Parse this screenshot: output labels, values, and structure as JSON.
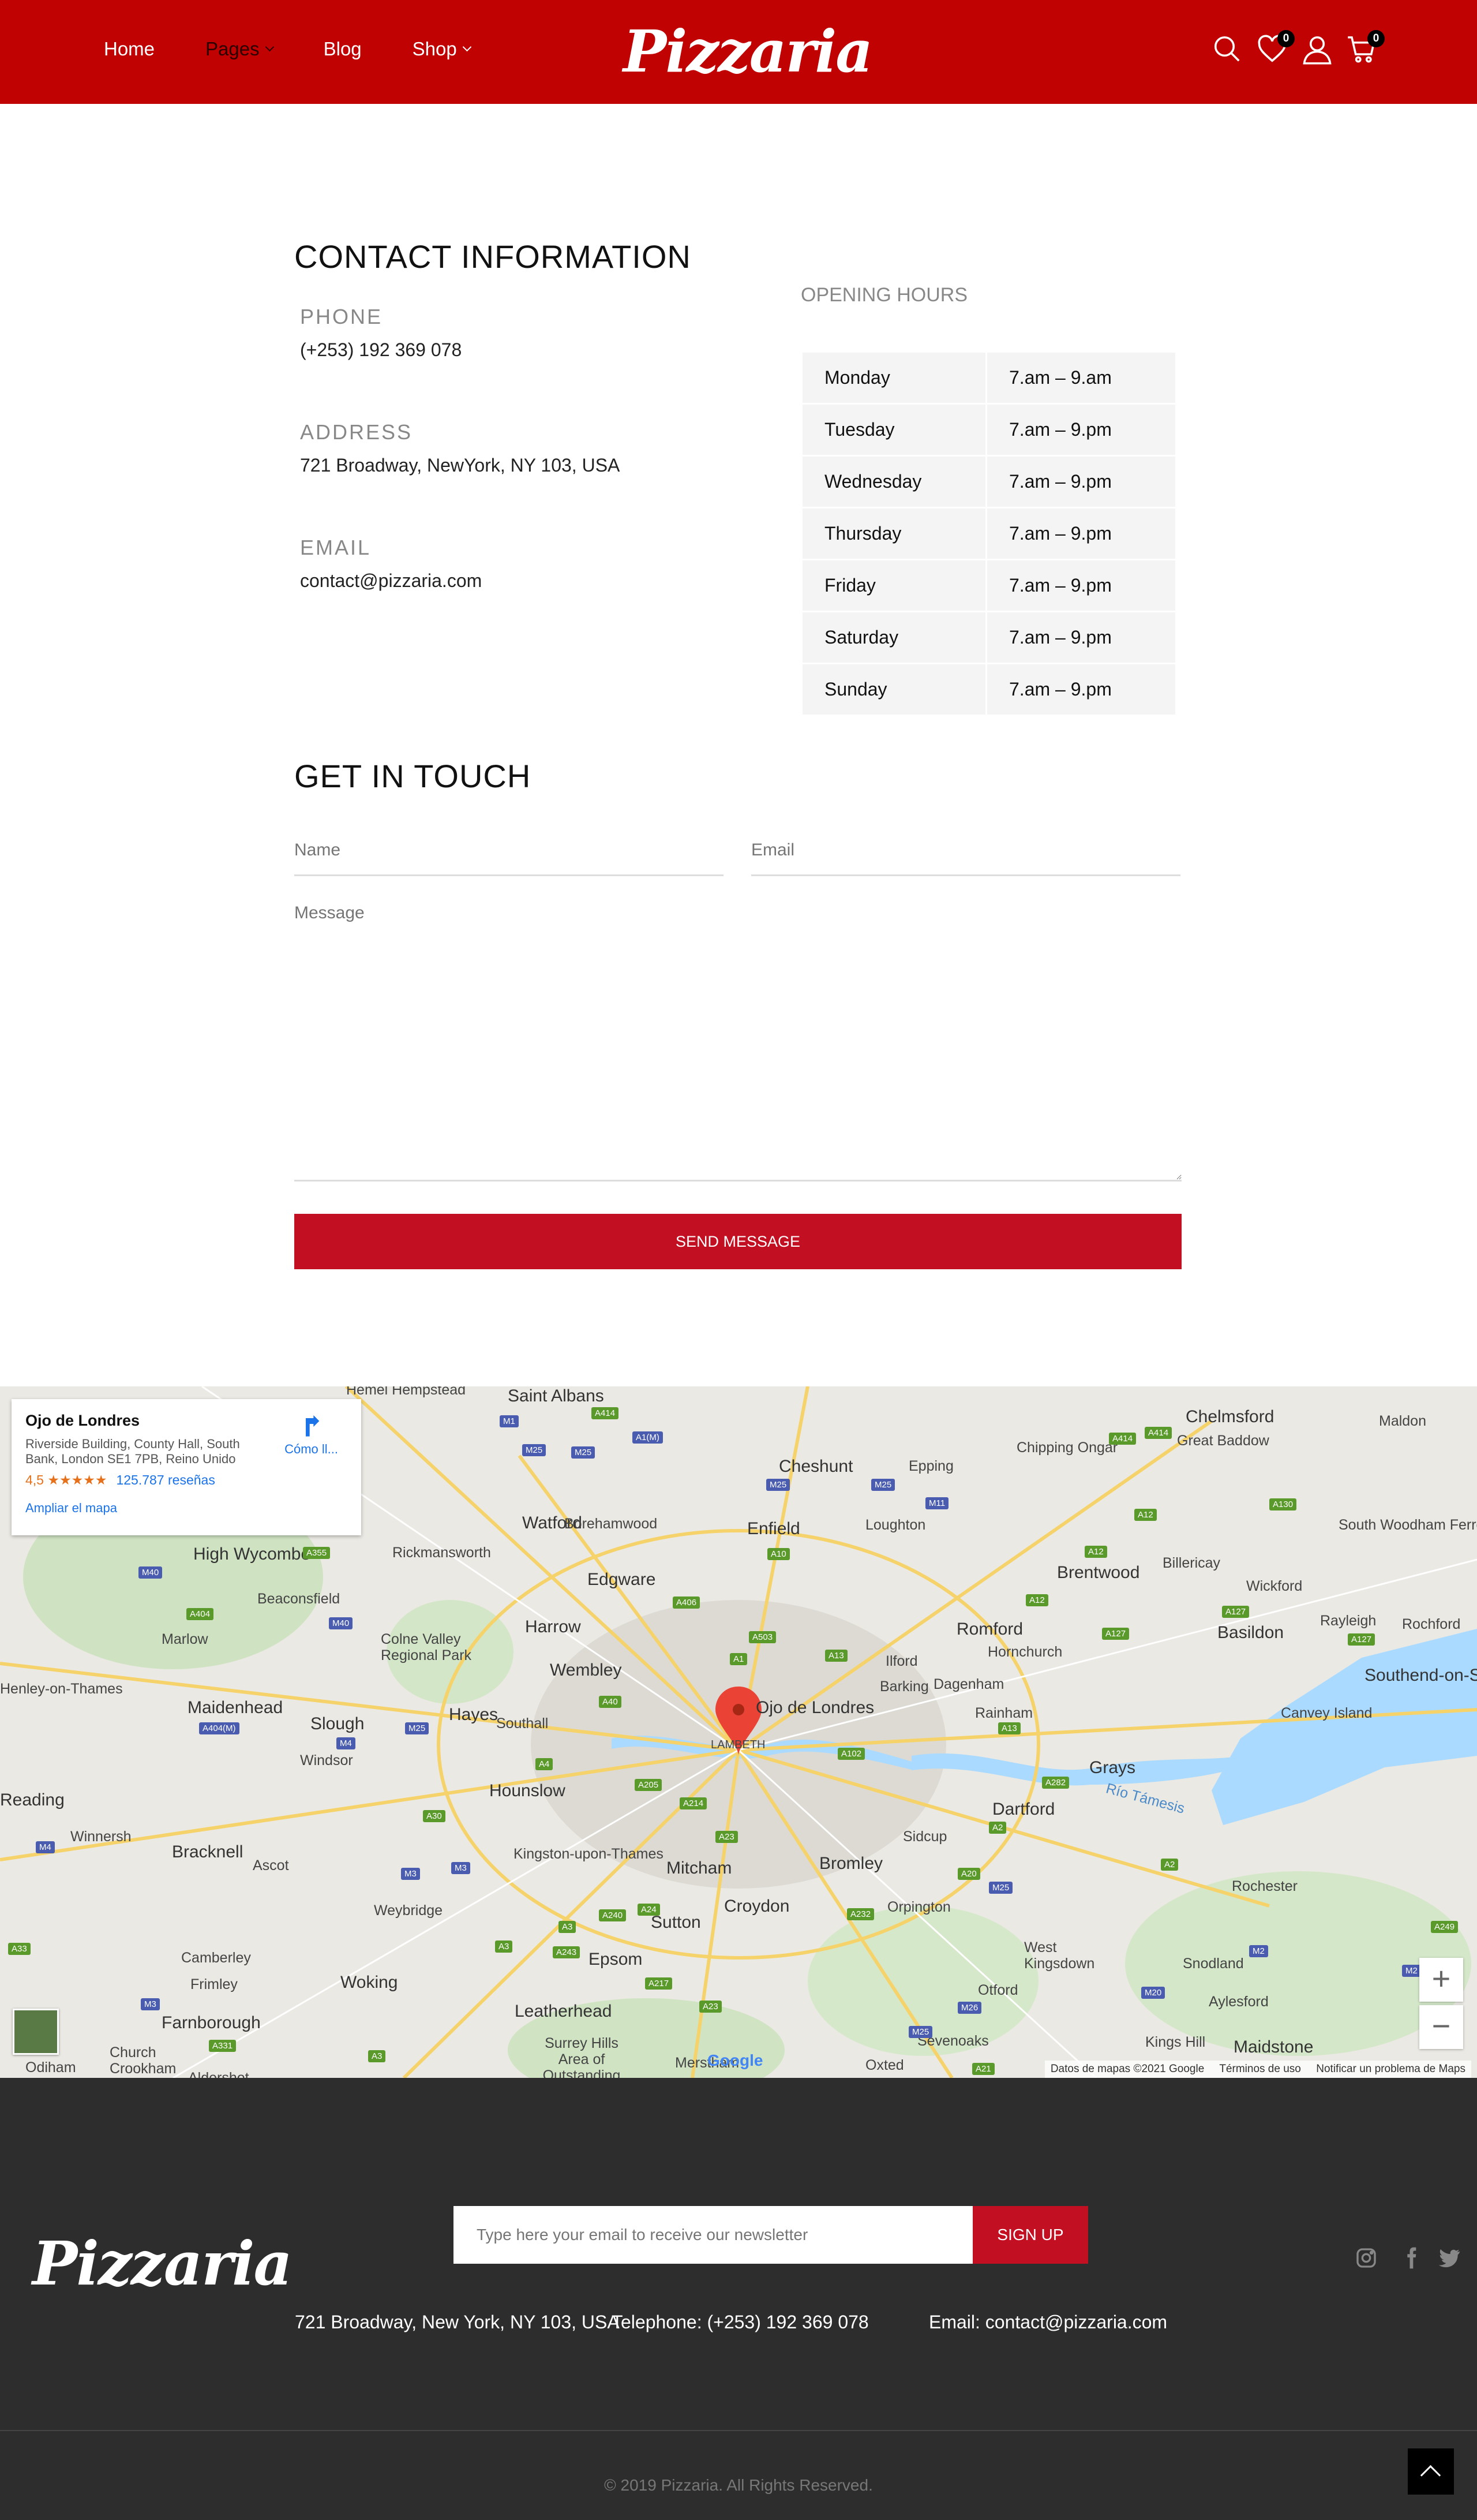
{
  "header": {
    "nav": [
      {
        "label": "Home"
      },
      {
        "label": "Pages"
      },
      {
        "label": "Blog"
      },
      {
        "label": "Shop"
      }
    ],
    "logo_text": "Pizzaria",
    "wishlist_count": "0",
    "cart_count": "0"
  },
  "contact": {
    "title": "CONTACT INFORMATION",
    "phone_label": "PHONE",
    "phone": "(+253) 192 369 078",
    "address_label": "ADDRESS",
    "address": "721 Broadway, NewYork, NY 103, USA",
    "email_label": "EMAIL",
    "email": "contact@pizzaria.com"
  },
  "hours": {
    "title": "OPENING HOURS",
    "rows": [
      {
        "day": "Monday",
        "time": "7.am – 9.am"
      },
      {
        "day": "Tuesday",
        "time": "7.am – 9.pm"
      },
      {
        "day": "Wednesday",
        "time": "7.am – 9.pm"
      },
      {
        "day": "Thursday",
        "time": "7.am – 9.pm"
      },
      {
        "day": "Friday",
        "time": "7.am – 9.pm"
      },
      {
        "day": "Saturday",
        "time": "7.am – 9.pm"
      },
      {
        "day": "Sunday",
        "time": "7.am – 9.pm"
      }
    ]
  },
  "form": {
    "title": "GET IN TOUCH",
    "name_placeholder": "Name",
    "email_placeholder": "Email",
    "message_placeholder": "Message",
    "submit": "SEND MESSAGE"
  },
  "map": {
    "place_name": "Ojo de Londres",
    "place_address": "Riverside Building, County Hall, South Bank, London SE1 7PB, Reino Unido",
    "rating": "4,5 ★★★★★",
    "reviews": "125.787 reseñas",
    "directions": "Cómo ll...",
    "enlarge": "Ampliar el mapa",
    "marker_label": "Ojo de Londres",
    "zoom_in": "+",
    "zoom_out": "−",
    "google": "Google",
    "attribution": "Datos de mapas ©2021 Google",
    "terms": "Términos de uso",
    "report": "Notificar un problema de Maps",
    "places": [
      "Hemel Hempstead",
      "Saint Albans",
      "Chelmsford",
      "Maldon",
      "Cheshunt",
      "Epping",
      "Chipping Ongar",
      "Great Baddow",
      "Watford",
      "Borehamwood",
      "Enfield",
      "Loughton",
      "Brentwood",
      "South Woodham Ferrers",
      "High Wycombe",
      "Rickmansworth",
      "Edgware",
      "Billericay",
      "Wickford",
      "Beaconsfield",
      "Harrow",
      "Romford",
      "Rayleigh",
      "Basildon",
      "Rochford",
      "Marlow",
      "Colne Valley Regional Park",
      "Wembley",
      "Ilford",
      "Hornchurch",
      "Southend-on-S",
      "Henley-on-Thames",
      "Maidenhead",
      "Slough",
      "Hayes",
      "Southall",
      "Barking",
      "Dagenham",
      "Canvey Island",
      "Windsor",
      "LAMBETH",
      "Rainham",
      "Hounslow",
      "Grays",
      "Reading",
      "Dartford",
      "Río Támesis",
      "Winnersh",
      "Bracknell",
      "Ascot",
      "Kingston-upon-Thames",
      "Mitcham",
      "Sidcup",
      "Bromley",
      "Weybridge",
      "Croydon",
      "Orpington",
      "Rochester",
      "Sutton",
      "Camberley",
      "Woking",
      "Epsom",
      "West Kingsdown",
      "Snodland",
      "Frimley",
      "Leatherhead",
      "Otford",
      "Aylesford",
      "Farnborough",
      "Surrey Hills Area of Outstanding",
      "Sevenoaks",
      "Kings Hill",
      "Maidstone",
      "Church Crookham",
      "Odiham",
      "Aldershot",
      "Merstham",
      "Oxted"
    ]
  },
  "footer": {
    "logo_text": "Pizzaria",
    "newsletter_placeholder": "Type here your email to receive our newsletter",
    "signup": "SIGN UP",
    "address": "721 Broadway, New York, NY 103, USA",
    "phone": "Telephone: (+253) 192 369 078",
    "email": "Email: contact@pizzaria.com",
    "copyright": "© 2019 Pizzaria. All Rights Reserved."
  },
  "colors": {
    "brand_red": "#c00202",
    "button_red": "#c30f22",
    "footer_bg": "#2d2d2d"
  }
}
